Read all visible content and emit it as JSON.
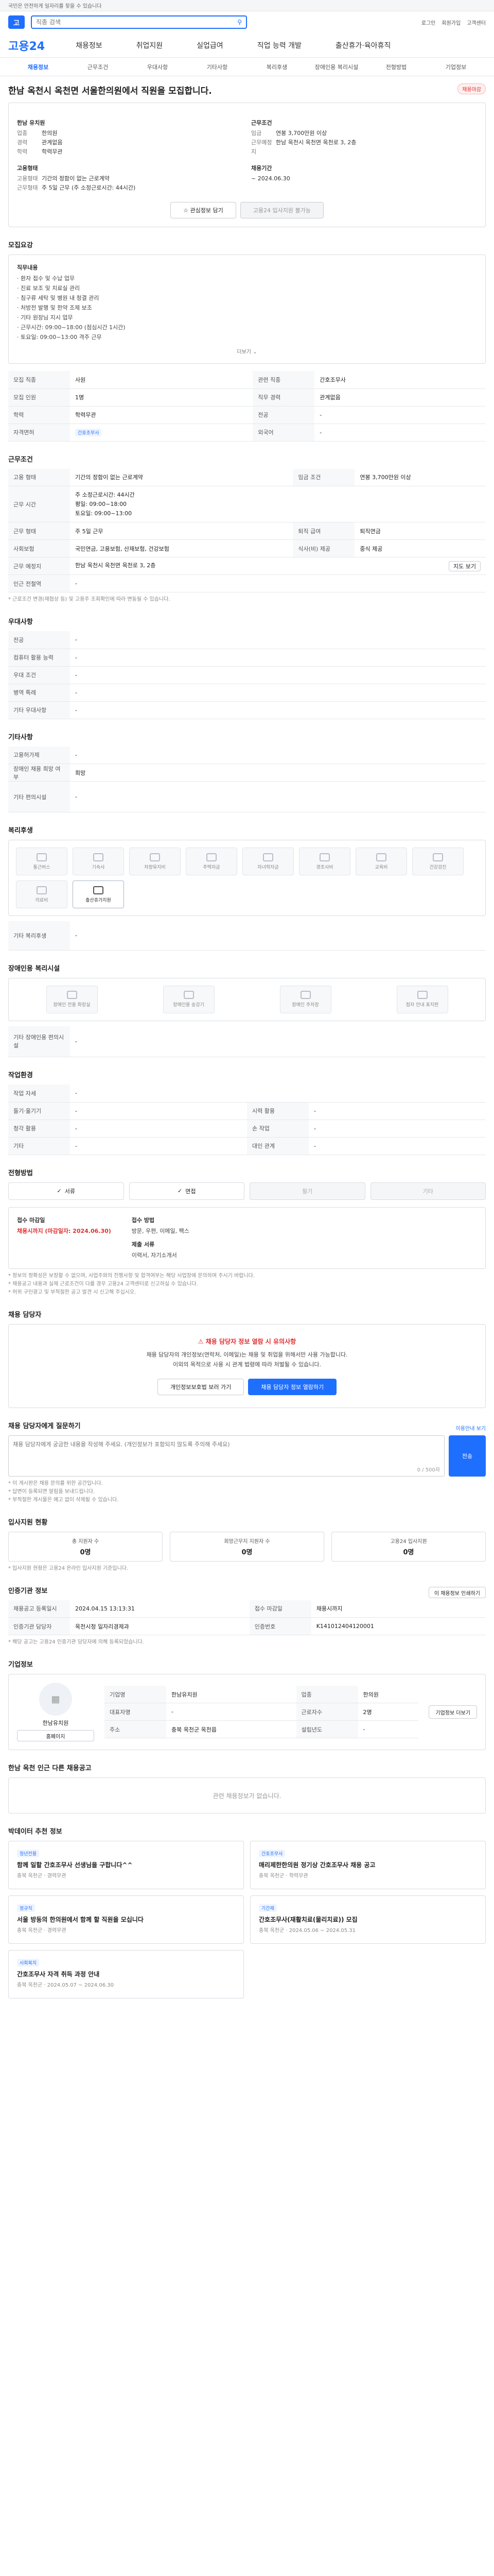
{
  "topbar": {
    "notice": "국민은 안전하게 일자리를 찾을 수 있습니다"
  },
  "header": {
    "logo": "고",
    "search_placeholder": "직종 검색",
    "util": [
      "로그인",
      "회원가입",
      "고객센터"
    ]
  },
  "gnb": {
    "brand": "고용24",
    "menu": [
      "채용정보",
      "취업지원",
      "실업급여",
      "직업 능력 개발",
      "출산휴가·육아휴직"
    ]
  },
  "subnav": [
    "채용정보",
    "근무조건",
    "우대사항",
    "기타사항",
    "복리후생",
    "장애인용 복리시설",
    "전형방법",
    "기업정보"
  ],
  "job": {
    "company": "한남 유치원",
    "title": "한남 옥천시 옥천면 서울한의원에서 직원을 모집합니다.",
    "badge": "채용마감",
    "left": [
      [
        "업종",
        "한의원"
      ],
      [
        "경력",
        "관계없음"
      ],
      [
        "학력",
        "학력무관"
      ]
    ],
    "right_title": "근무조건",
    "right": [
      [
        "임금",
        "연봉 3,700만원 이상"
      ],
      [
        "근무예정지",
        "한남 옥천시 옥천면 옥천로 3, 2층"
      ]
    ],
    "employment_label": "고용형태",
    "employment": [
      [
        "고용형태",
        "기간의 정함이 없는 근로계약"
      ],
      [
        "근무형태",
        "주 5일 근무 (주 소정근로시간: 44시간)"
      ]
    ],
    "period_label": "채용기간",
    "period": "~ 2024.06.30",
    "btn_scrap": "관심정보 담기",
    "btn_apply": "고용24 입사지원 불가능"
  },
  "detail": {
    "title": "모집요강",
    "desc_head": "직무내용",
    "desc": [
      "· 환자 접수 및 수납 업무",
      "· 진료 보조 및 치료실 관리",
      "· 침구류 세탁 및 병원 내 청결 관리",
      "· 처방전 발행 및 한약 조제 보조",
      "· 기타 원장님 지시 업무",
      "· 근무시간: 09:00~18:00 (점심시간 1시간)",
      "· 토요일: 09:00~13:00 격주 근무"
    ],
    "more": "더보기",
    "rows": [
      [
        "모집 직종",
        "사원",
        "관련 직종",
        "간호조무사"
      ],
      [
        "모집 인원",
        "1명",
        "직무 경력",
        "관계없음"
      ],
      [
        "학력",
        "학력무관",
        "전공",
        "-"
      ],
      [
        "자격면허",
        "간호조무사",
        "외국어",
        "-"
      ]
    ]
  },
  "conditions": {
    "title": "근무조건",
    "rows": [
      [
        "고용 형태",
        "기간의 정함이 없는 근로계약",
        "임금 조건",
        "연봉 3,700만원 이상"
      ],
      [
        "근무 시간",
        "주 소정근로시간: 44시간",
        "",
        ""
      ],
      [
        "근무 형태",
        "주 5일 근무",
        "퇴직 급여",
        "퇴직연금"
      ],
      [
        "사회보험",
        "국민연금, 고용보험, 산재보험, 건강보험",
        "식사(비) 제공",
        "중식 제공"
      ],
      [
        "근무 예정지",
        "한남 옥천시 옥천면 옥천로 3, 2층",
        "",
        ""
      ],
      [
        "인근 전철역",
        "-",
        "",
        ""
      ]
    ],
    "worktime": "평일: 09:00~18:00",
    "worktime2": "토요일: 09:00~13:00",
    "map_btn": "지도 보기",
    "note": "* 근로조건 변경(재협상 등) 및 고용주 조회확인에 따라 변동될 수 있습니다."
  },
  "prefer": {
    "title": "우대사항",
    "rows": [
      [
        "전공",
        "-"
      ],
      [
        "컴퓨터 활용 능력",
        "-"
      ],
      [
        "우대 조건",
        "-"
      ],
      [
        "병역 특례",
        "-"
      ],
      [
        "기타 우대사항",
        "-"
      ]
    ]
  },
  "etc": {
    "title": "기타사항",
    "rows": [
      [
        "고용허가제",
        "-"
      ],
      [
        "장애인 채용 희망 여부",
        "희망"
      ],
      [
        "기타 편의시설",
        "-"
      ]
    ]
  },
  "welfare": {
    "title": "복리후생",
    "items": [
      "통근버스",
      "기숙사",
      "차량유지비",
      "주택자금",
      "자녀학자금",
      "경조사비",
      "교육비",
      "건강검진",
      "의료비",
      "출산휴가지원"
    ],
    "active": "출산휴가지원",
    "etc_label": "기타 복리후생",
    "etc": "-"
  },
  "facility": {
    "title": "장애인용 복리시설",
    "items": [
      "장애인 전용 화장실",
      "장애인용 승강기",
      "장애인 주차장",
      "점자 안내 표지판"
    ],
    "etc_label": "기타 장애인용 편의시설",
    "etc": "-"
  },
  "worker": {
    "title": "작업환경",
    "rows": [
      [
        "작업 자세",
        "-",
        "",
        ""
      ],
      [
        "들기·옮기기",
        "-",
        "시력 활용",
        "-"
      ],
      [
        "청각 활용",
        "-",
        "손 작업",
        "-"
      ],
      [
        "기타",
        "-",
        "대인 관계",
        "-"
      ]
    ]
  },
  "screening": {
    "title": "전형방법",
    "methods": [
      "서류",
      "면접",
      "필기",
      "기타"
    ],
    "active": [
      "서류",
      "면접"
    ],
    "docs_label": "접수 마감일",
    "docs": "채용시까지 (마감일자: 2024.06.30)",
    "submit_label": "접수 방법",
    "submit": "방문, 우편, 이메일, 팩스",
    "req_label": "제출 서류",
    "req": "이력서, 자기소개서",
    "notes": [
      "* 정보의 정확성은 보장할 수 없으며, 사업주와의 진행사항 및 합격여부는 해당 사업장에 문의하여 주시기 바랍니다.",
      "* 채용공고 내용과 실제 근로조건이 다를 경우 고용24 고객센터로 신고하실 수 있습니다.",
      "* 허위 구인광고 및 부적절한 공고 발견 시 신고해 주십시오."
    ]
  },
  "contact": {
    "title": "채용 담당자",
    "alert": "채용 담당자 정보 열람 시 유의사항",
    "alert_desc": [
      "채용 담당자의 개인정보(연락처, 이메일)는 채용 및 취업을 위해서만 사용 가능합니다.",
      "이외의 목적으로 사용 시 관계 법령에 따라 처벌될 수 있습니다."
    ],
    "btn_agree": "개인정보보호법 보러 가기",
    "btn_view": "채용 담당자 정보 열람하기"
  },
  "inquiry": {
    "title": "채용 담당자에게 질문하기",
    "placeholder": "채용 담당자에게 궁금한 내용을 작성해 주세요. (개인정보가 포함되지 않도록 주의해 주세요)",
    "count": "0 / 500자",
    "submit": "전송",
    "notes": [
      "* 이 게시판은 채용 문의를 위한 공간입니다.",
      "* 답변이 등록되면 알림을 보내드립니다.",
      "* 부적절한 게시물은 예고 없이 삭제될 수 있습니다."
    ],
    "link": "이용안내 보기"
  },
  "channels": {
    "title": "입사지원 현황",
    "items": [
      [
        "총 지원자 수",
        "0명"
      ],
      [
        "희망근무지 지원자 수",
        "0명"
      ],
      [
        "고용24 입사지원",
        "0명"
      ]
    ],
    "note": "* 입사지원 현황은 고용24 온라인 입사지원 기준입니다."
  },
  "info": {
    "title": "인증기관 정보",
    "btn": "이 채용정보 인쇄하기",
    "rows": [
      [
        "채용공고 등록일시",
        "2024.04.15 13:13:31",
        "접수 마감일",
        "채용시까지"
      ],
      [
        "인증기관 담당자",
        "옥천시청 일자리경제과",
        "인증번호",
        "K141012404120001"
      ]
    ],
    "note": "* 해당 공고는 고용24 인증기관 담당자에 의해 등록되었습니다."
  },
  "company": {
    "title": "기업정보",
    "name": "한남유치원",
    "rows": [
      [
        "기업명",
        "한남유치원",
        "업종",
        "한의원"
      ],
      [
        "대표자명",
        "-",
        "근로자수",
        "2명"
      ],
      [
        "주소",
        "충북 옥천군 옥천읍",
        "설립년도",
        "-"
      ]
    ],
    "btn": "기업정보 더보기",
    "btn2": "홈페이지"
  },
  "similar": {
    "title": "한남 옥천 인근 다른 채용공고",
    "empty": "관련 채용정보가 없습니다."
  },
  "youth": {
    "title": "박데이터 추천 정보",
    "cards": [
      {
        "tag": "청년전용",
        "t": "함께 일할 간호조무사 선생님을 구합니다^^",
        "s": "충북 옥천군 · 경력무관"
      },
      {
        "tag": "간호조무사",
        "t": "매리제한한의원 정기상 간호조무사 채용 공고",
        "s": "충북 옥천군 · 학력무관"
      },
      {
        "tag": "정규직",
        "t": "서울 방동의 한의원에서 함께 할 직원을 모십니다",
        "s": "충북 옥천군 · 경력무관"
      },
      {
        "tag": "기간제",
        "t": "간호조무사(재활치료(물리치료)) 모집",
        "s": "충북 옥천군 · 2024.05.06 ~ 2024.05.31"
      },
      {
        "tag": "사회복지",
        "t": "간호조무사 자격 취득 과정 안내",
        "s": "충북 옥천군 · 2024.05.07 ~ 2024.06.30"
      }
    ]
  }
}
